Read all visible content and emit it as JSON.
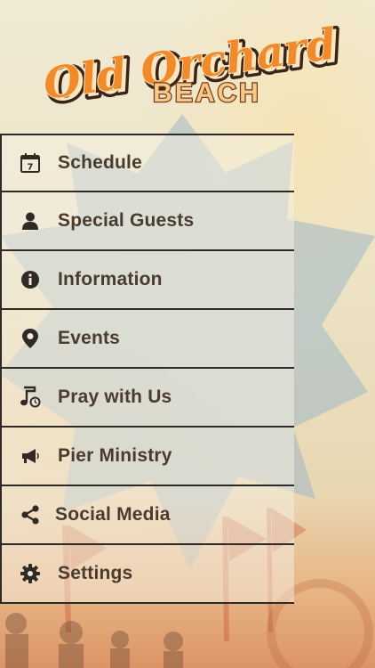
{
  "header": {
    "logo_line1": "Old Orchard",
    "logo_line2": "BEACH"
  },
  "menu": {
    "items": [
      {
        "label": "Schedule",
        "icon": "calendar-icon"
      },
      {
        "label": "Special Guests",
        "icon": "person-icon"
      },
      {
        "label": "Information",
        "icon": "info-icon"
      },
      {
        "label": "Events",
        "icon": "map-pin-icon"
      },
      {
        "label": "Pray with Us",
        "icon": "music-note-icon"
      },
      {
        "label": "Pier Ministry",
        "icon": "megaphone-icon"
      },
      {
        "label": "Social Media",
        "icon": "share-icon"
      },
      {
        "label": "Settings",
        "icon": "gear-icon"
      }
    ]
  },
  "calendar_day": "7",
  "colors": {
    "menu_text": "#4a3b2e",
    "divider": "#2d2a28",
    "logo_orange": "#f08a2a",
    "logo_cream": "#fbe7bf",
    "star_blue": "#9fb8c6"
  }
}
